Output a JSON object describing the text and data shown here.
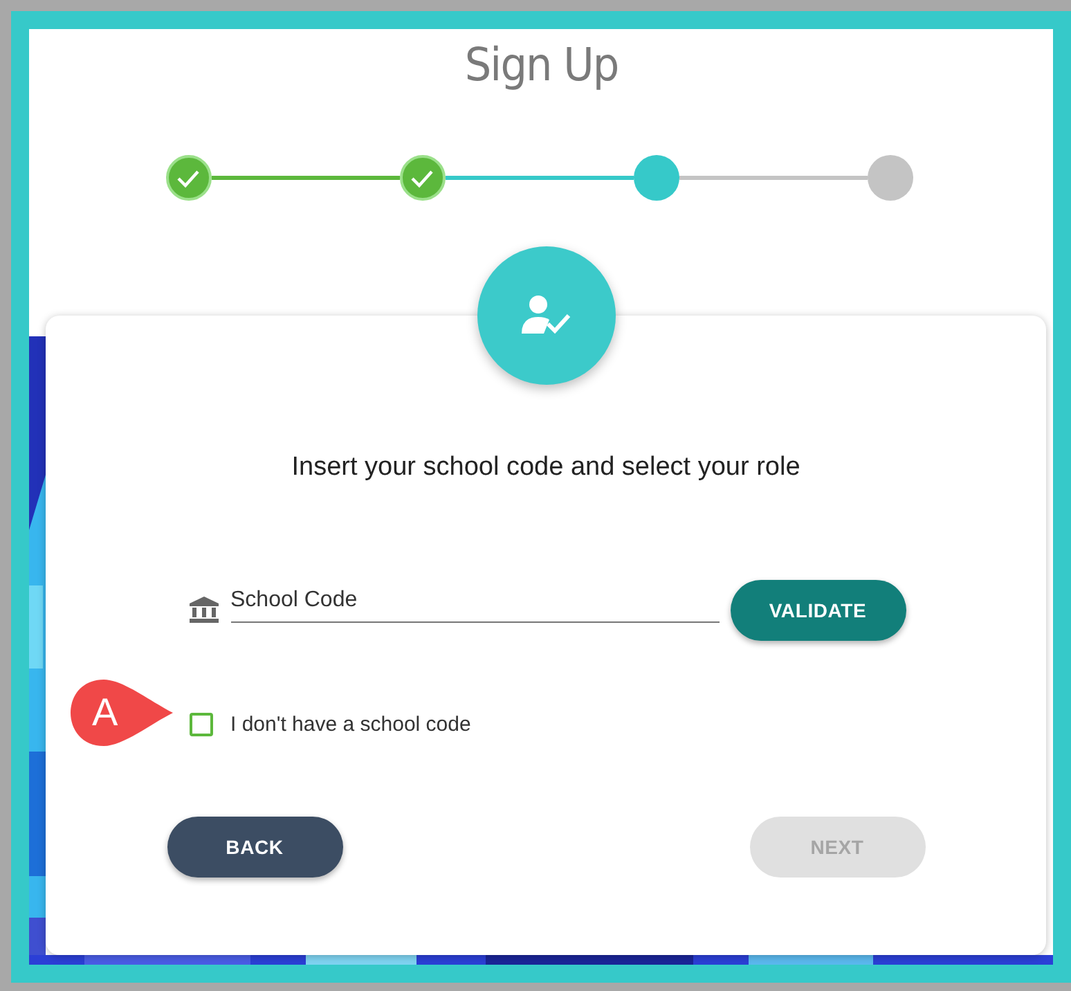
{
  "title": "Sign Up",
  "steps": [
    {
      "done": true,
      "active": false
    },
    {
      "done": true,
      "active": false
    },
    {
      "done": false,
      "active": true
    },
    {
      "done": false,
      "active": false
    }
  ],
  "card": {
    "heading": "Insert your school code and select your role",
    "field": {
      "placeholder": "School Code"
    },
    "validate_button": "VALIDATE",
    "checkbox": {
      "label": "I don't have a school code",
      "checked": false
    },
    "back_button": "BACK",
    "next_button": {
      "label": "NEXT",
      "disabled": true
    }
  },
  "callout": {
    "label": "A"
  }
}
